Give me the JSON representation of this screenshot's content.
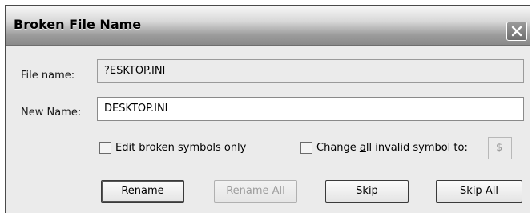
{
  "dialog": {
    "title": "Broken File Name",
    "close_icon": "close-icon"
  },
  "fields": {
    "file_name_label": "File name:",
    "file_name_value": "?ESKTOP.INI",
    "new_name_label": "New Name:",
    "new_name_value": "DESKTOP.INI"
  },
  "options": {
    "edit_broken_label": "Edit broken symbols only",
    "edit_broken_checked": false,
    "change_invalid_label": {
      "before": "Change ",
      "mnemonic": "a",
      "after": "ll invalid symbol to:"
    },
    "change_invalid_checked": false,
    "replacement_symbol": "$"
  },
  "buttons": {
    "rename": "Rename",
    "rename_all": "Rename All",
    "skip": {
      "mnemonic": "S",
      "rest": "kip"
    },
    "skip_all": {
      "mnemonic": "S",
      "rest": "kip All"
    }
  }
}
